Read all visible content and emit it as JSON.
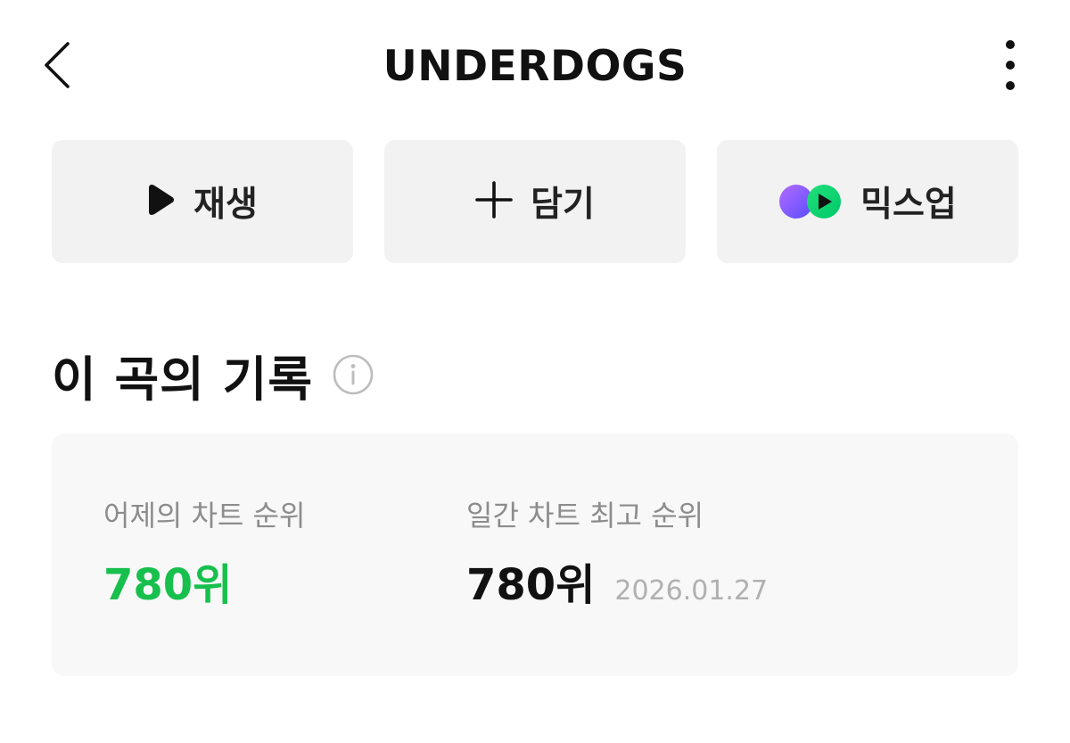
{
  "header": {
    "title": "UNDERDOGS",
    "back_icon": "chevron-left-icon",
    "more_icon": "more-vertical-icon"
  },
  "actions": {
    "play_label": "재생",
    "add_label": "담기",
    "mixup_label": "믹스업"
  },
  "section": {
    "title": "이 곡의 기록",
    "info_icon": "info-icon"
  },
  "record": {
    "yesterday_label": "어제의 차트 순위",
    "yesterday_value": "780위",
    "best_label": "일간 차트 최고 순위",
    "best_value": "780위",
    "best_date": "2026.01.27"
  },
  "colors": {
    "accent_green": "#17c04d",
    "button_bg": "#f2f2f2",
    "card_bg": "#f8f8f8",
    "label_gray": "#8c8c8c"
  }
}
